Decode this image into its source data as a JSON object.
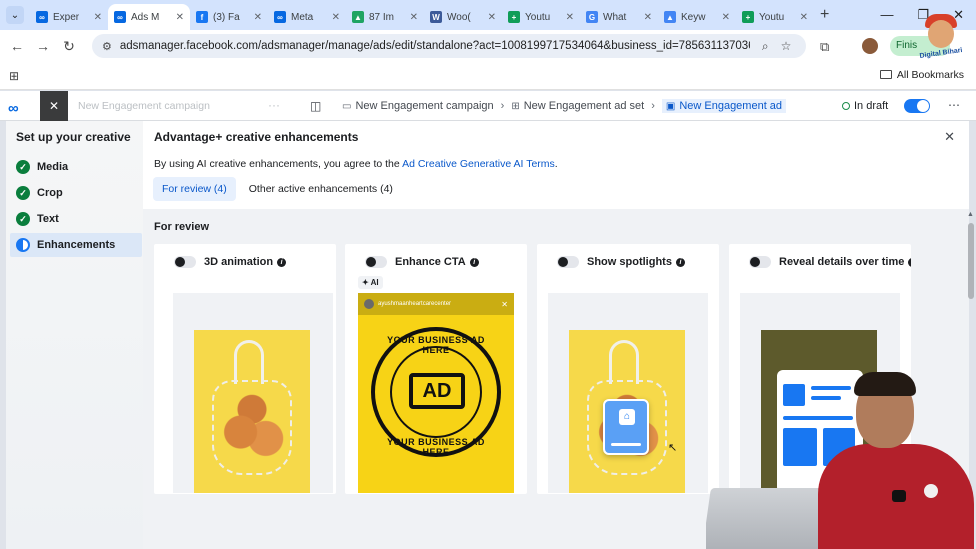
{
  "browser": {
    "tabs": [
      {
        "label": "Exper",
        "fav_color": "#0668e1",
        "fav_glyph": "∞",
        "active": false
      },
      {
        "label": "Ads M",
        "fav_color": "#0668e1",
        "fav_glyph": "∞",
        "active": true
      },
      {
        "label": "(3) Fa",
        "fav_color": "#1877f2",
        "fav_glyph": "f",
        "active": false
      },
      {
        "label": "Meta",
        "fav_color": "#0668e1",
        "fav_glyph": "∞",
        "active": false
      },
      {
        "label": "87 Im",
        "fav_color": "#1fa463",
        "fav_glyph": "▲",
        "active": false
      },
      {
        "label": "Woo(",
        "fav_color": "#3c5a99",
        "fav_glyph": "W",
        "active": false
      },
      {
        "label": "Youtu",
        "fav_color": "#0f9d58",
        "fav_glyph": "+",
        "active": false
      },
      {
        "label": "What",
        "fav_color": "#4285f4",
        "fav_glyph": "G",
        "active": false
      },
      {
        "label": "Keyw",
        "fav_color": "#4285f4",
        "fav_glyph": "▲",
        "active": false
      },
      {
        "label": "Youtu",
        "fav_color": "#0f9d58",
        "fav_glyph": "+",
        "active": false
      }
    ],
    "url": "adsmanager.facebook.com/adsmanager/manage/ads/edit/standalone?act=1008199717534064&business_id=785631137036741&gl...",
    "finish_label": "Finis",
    "all_bookmarks": "All Bookmarks"
  },
  "header": {
    "campaign_ghost": "New Engagement campaign",
    "breadcrumbs": [
      {
        "label": "New Engagement campaign",
        "icon": "folder-icon"
      },
      {
        "label": "New Engagement ad set",
        "icon": "grid-icon"
      },
      {
        "label": "New Engagement ad",
        "icon": "ad-icon"
      }
    ],
    "status": "In draft"
  },
  "steps": {
    "title": "Set up your creative",
    "items": [
      {
        "label": "Media",
        "state": "done"
      },
      {
        "label": "Crop",
        "state": "done"
      },
      {
        "label": "Text",
        "state": "done"
      },
      {
        "label": "Enhancements",
        "state": "active"
      }
    ]
  },
  "panel": {
    "title": "Advantage+ creative enhancements",
    "terms_prefix": "By using AI creative enhancements, you agree to the ",
    "terms_link": "Ad Creative Generative AI Terms",
    "terms_suffix": ".",
    "tabs": [
      "For review (4)",
      "Other active enhancements (4)"
    ],
    "section_label": "For review",
    "cards": [
      {
        "title": "3D animation",
        "ai": false
      },
      {
        "title": "Enhance CTA",
        "ai": true,
        "ai_label": "AI",
        "ig_handle": "ayushmaanheartcarecenter",
        "seal_top": "YOUR BUSINESS AD HERE",
        "seal_bottom": "YOUR BUSINESS AD HERE",
        "seal_center": "AD"
      },
      {
        "title": "Show spotlights",
        "ai": false
      },
      {
        "title": "Reveal details over time",
        "ai": false
      }
    ]
  },
  "colors": {
    "accent": "#1877f2",
    "done_green": "#0a7e3d",
    "product_yellow": "#f6d94a"
  },
  "overlay": {
    "channel_name": "Digital Bihari"
  }
}
